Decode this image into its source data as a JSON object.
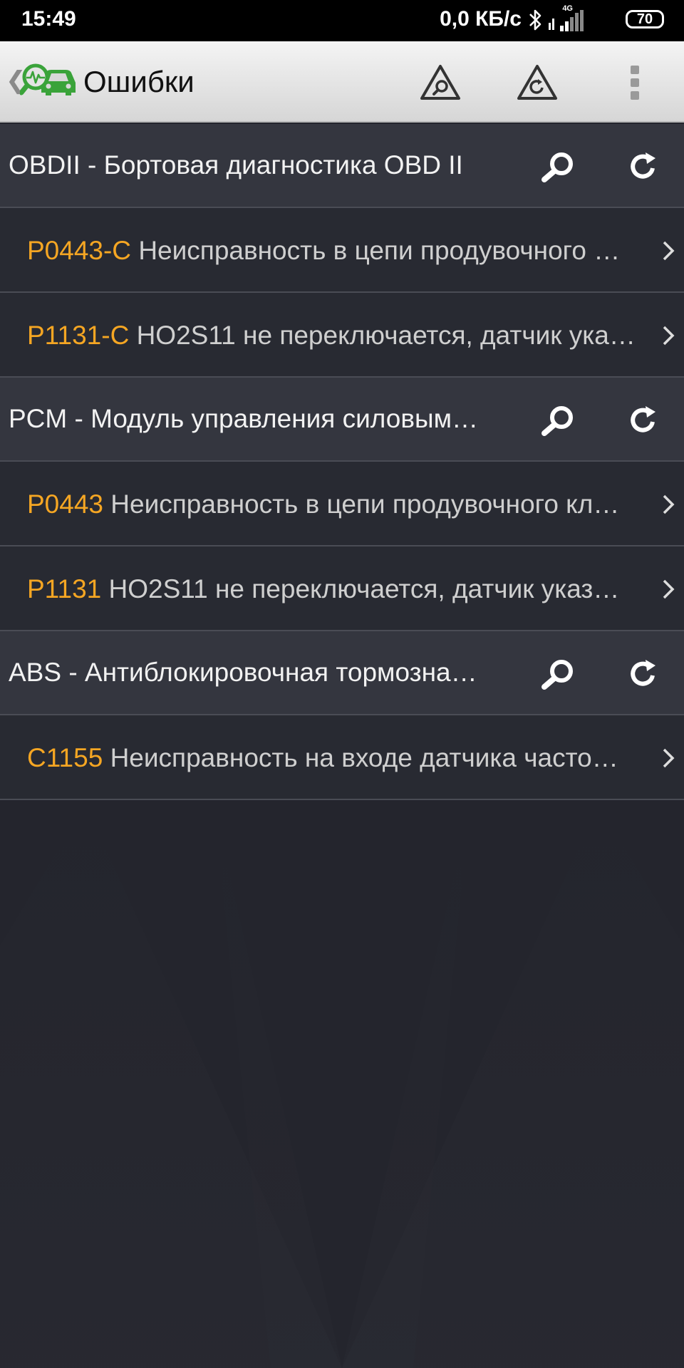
{
  "status_bar": {
    "time": "15:49",
    "network_speed": "0,0 КБ/с",
    "network_type": "4G",
    "battery": "70"
  },
  "toolbar": {
    "title": "Ошибки",
    "back_glyph": "❮"
  },
  "groups": [
    {
      "label": "OBDII - Бортовая диагностика OBD II",
      "errors": [
        {
          "code": "P0443-C",
          "description": "Неисправность в цепи продувочного …"
        },
        {
          "code": "P1131-C",
          "description": "HO2S11 не переключается, датчик ука…"
        }
      ]
    },
    {
      "label": "PCM - Модуль управления силовым…",
      "errors": [
        {
          "code": "P0443",
          "description": "Неисправность в цепи продувочного кл…"
        },
        {
          "code": "P1131",
          "description": "HO2S11 не переключается, датчик указ…"
        }
      ]
    },
    {
      "label": "ABS - Антиблокировочная тормозна…",
      "errors": [
        {
          "code": "C1155",
          "description": "Неисправность на входе датчика часто…"
        }
      ]
    }
  ],
  "colors": {
    "accent_code": "#f5a623",
    "logo_green": "#3aa33a",
    "background": "#24252d",
    "group_row": "#34363f",
    "error_row": "#282a32"
  },
  "icons": {
    "search": "magnifier-icon",
    "refresh": "refresh-icon",
    "chevron": "chevron-right-icon",
    "menu": "overflow-menu-icon"
  }
}
